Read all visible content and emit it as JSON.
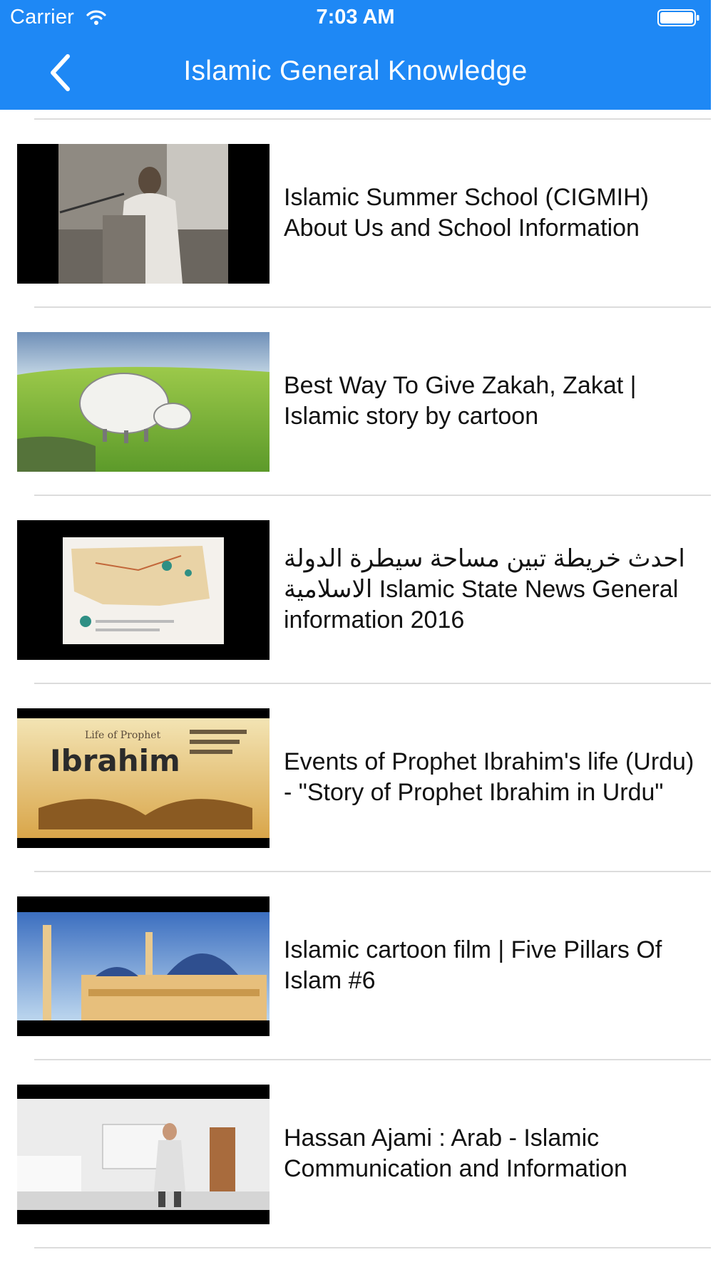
{
  "status_bar": {
    "carrier": "Carrier",
    "time": "7:03 AM",
    "wifi_icon": "wifi-icon",
    "battery_icon": "battery-icon"
  },
  "nav": {
    "back_icon": "chevron-left-icon",
    "title": "Islamic General Knowledge"
  },
  "colors": {
    "nav_bar": "#1e88f5",
    "text": "#111111",
    "separator": "#dcdcdc"
  },
  "videos": [
    {
      "title": "Islamic Summer School (CIGMIH) About Us and School Information"
    },
    {
      "title": "Best Way To Give Zakah, Zakat | Islamic story by cartoon"
    },
    {
      "title": "احدث خريطة تبين مساحة سيطرة الدولة الاسلامية Islamic State News General information 2016"
    },
    {
      "title": "Events of Prophet Ibrahim's life (Urdu) - \"Story of Prophet Ibrahim in Urdu\""
    },
    {
      "title": "Islamic cartoon film | Five Pillars Of Islam #6"
    },
    {
      "title": "Hassan Ajami : Arab - Islamic Communication and Information"
    }
  ],
  "thumb_texts": {
    "ibrahim_small": "Life of Prophet",
    "ibrahim_big": "Ibrahim"
  }
}
